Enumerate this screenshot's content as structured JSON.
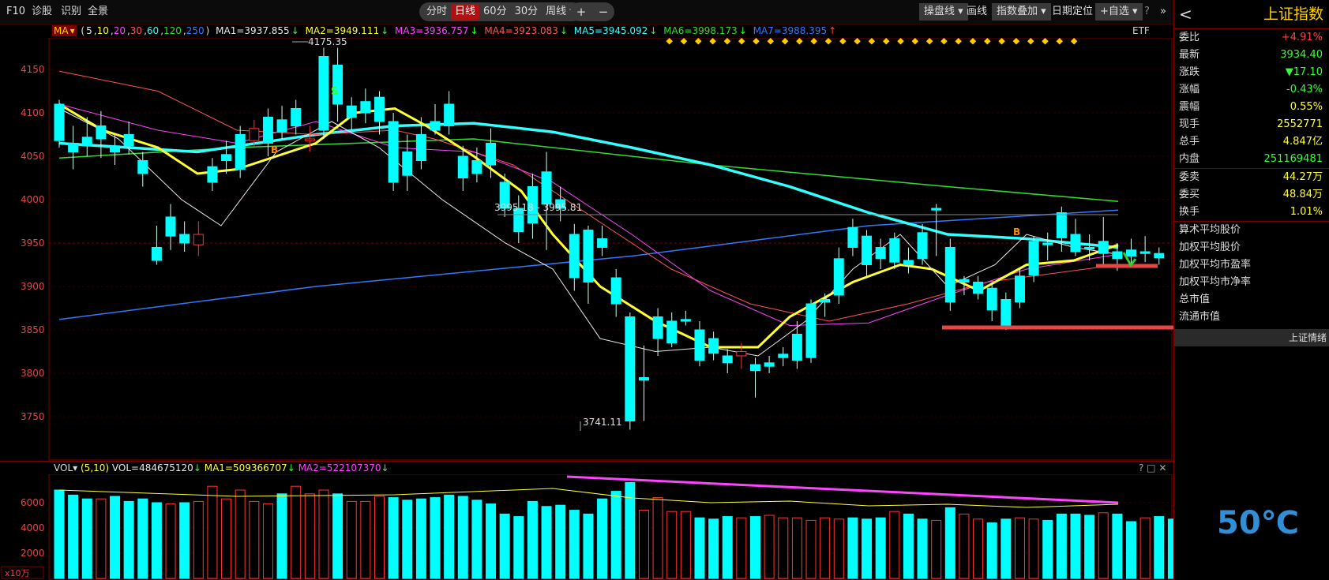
{
  "toolbar": {
    "left_items": [
      "F10",
      "诊股",
      "识别",
      "全景"
    ],
    "periods": [
      "分时",
      "日线",
      "60分",
      "30分",
      "周线"
    ],
    "active_period": "日线",
    "zoom_in": "+",
    "zoom_out": "−",
    "right_items": [
      "操盘线",
      "画线",
      "指数叠加",
      "日期定位",
      "自选"
    ],
    "help": "?",
    "close": "✕"
  },
  "ma_bar": {
    "name": "MA",
    "periods_prefix": "(",
    "periods": [
      "5",
      "10",
      "20",
      "30",
      "60",
      "120",
      "250"
    ],
    "periods_suffix": ")",
    "lines": [
      {
        "label": "MA1=3937.855",
        "arrow": "↓",
        "color": "#e8e8e8"
      },
      {
        "label": "MA2=3949.111",
        "arrow": "↓",
        "color": "#ffff33"
      },
      {
        "label": "MA3=3936.757",
        "arrow": "↓",
        "color": "#ff44ff"
      },
      {
        "label": "MA4=3923.083",
        "arrow": "↓",
        "color": "#ff5555"
      },
      {
        "label": "MA5=3945.092",
        "arrow": "↓",
        "color": "#33ffff"
      },
      {
        "label": "MA6=3998.173",
        "arrow": "↓",
        "color": "#33dd33"
      },
      {
        "label": "MA7=3988.395",
        "arrow": "↑",
        "color": "#3377ff"
      }
    ],
    "etf": "ETF"
  },
  "price_chart": {
    "y_ticks": [
      "4150",
      "4100",
      "4050",
      "4000",
      "3950",
      "3900",
      "3850",
      "3800",
      "3750"
    ],
    "high_label": "4175.35",
    "low_label": "3741.11",
    "range_label": "3995.18 - 3995.81",
    "signals": [
      "B",
      "S",
      "B"
    ],
    "colors": {
      "up": "#ff3333",
      "down": "#00ffff",
      "grid": "#3a0000"
    }
  },
  "volume": {
    "header": {
      "name": "VOL",
      "params": "(5,10)",
      "vol": "VOL=484675120",
      "vol_arrow": "↓",
      "ma1": "MA1=509366707",
      "ma1_arrow": "↓",
      "ma2": "MA2=522107370",
      "ma2_arrow": "↓",
      "icons": "? □ ✕"
    },
    "y_ticks": [
      "6000",
      "4000",
      "2000"
    ],
    "unit": "x10万"
  },
  "right_panel": {
    "title": "上证指数",
    "back": "<",
    "rows": [
      {
        "label": "委比",
        "value": "+4.91%",
        "color": "#ff4444"
      },
      {
        "label": "最新",
        "value": "3934.40",
        "color": "#33ff33"
      },
      {
        "label": "涨跌",
        "value": "▼17.10",
        "color": "#33ff33"
      },
      {
        "label": "涨幅",
        "value": "-0.43%",
        "color": "#33ff33"
      },
      {
        "label": "震幅",
        "value": "0.55%",
        "color": "#ffff33"
      },
      {
        "label": "现手",
        "value": "2552771",
        "color": "#ffff33"
      },
      {
        "label": "总手",
        "value": "4.847亿",
        "color": "#ffff33"
      },
      {
        "label": "内盘",
        "value": "251169481",
        "color": "#33ff33"
      }
    ],
    "rows2": [
      {
        "label": "委卖",
        "value": "44.27万",
        "color": "#ffff33"
      },
      {
        "label": "委买",
        "value": "48.84万",
        "color": "#ffff33"
      },
      {
        "label": "换手",
        "value": "1.01%",
        "color": "#ffff33"
      }
    ],
    "plain_rows": [
      "算术平均股价",
      "加权平均股价",
      "加权平均市盈率",
      "加权平均市净率",
      "总市值",
      "流通市值"
    ],
    "section": "上证情绪",
    "temperature": "50℃"
  }
}
